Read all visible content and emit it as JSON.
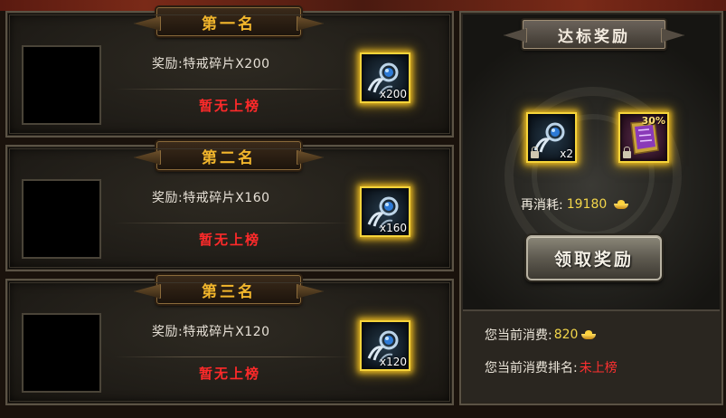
{
  "ranks": [
    {
      "title": "第一名",
      "reward": "奖励:特戒碎片X200",
      "status": "暂无上榜",
      "item_count": "x200",
      "item_icon": "ring-fragment-icon"
    },
    {
      "title": "第二名",
      "reward": "奖励:特戒碎片X160",
      "status": "暂无上榜",
      "item_count": "x160",
      "item_icon": "ring-fragment-icon"
    },
    {
      "title": "第三名",
      "reward": "奖励:特戒碎片X120",
      "status": "暂无上榜",
      "item_count": "x120",
      "item_icon": "ring-fragment-icon"
    }
  ],
  "side": {
    "title": "达标奖励",
    "items": [
      {
        "icon": "ring-fragment-icon",
        "count": "x2"
      },
      {
        "icon": "scroll-icon",
        "badge": "30%"
      }
    ],
    "reconsume_label": "再消耗:",
    "reconsume_value": "19180",
    "claim_label": "领取奖励",
    "current_spend_label": "您当前消费:",
    "current_spend_value": "820",
    "current_rank_label": "您当前消费排名:",
    "current_rank_value": "未上榜"
  },
  "colors": {
    "gold": "#f2b62c",
    "red_status": "#ff2a2a",
    "glow": "#f6d43a"
  }
}
